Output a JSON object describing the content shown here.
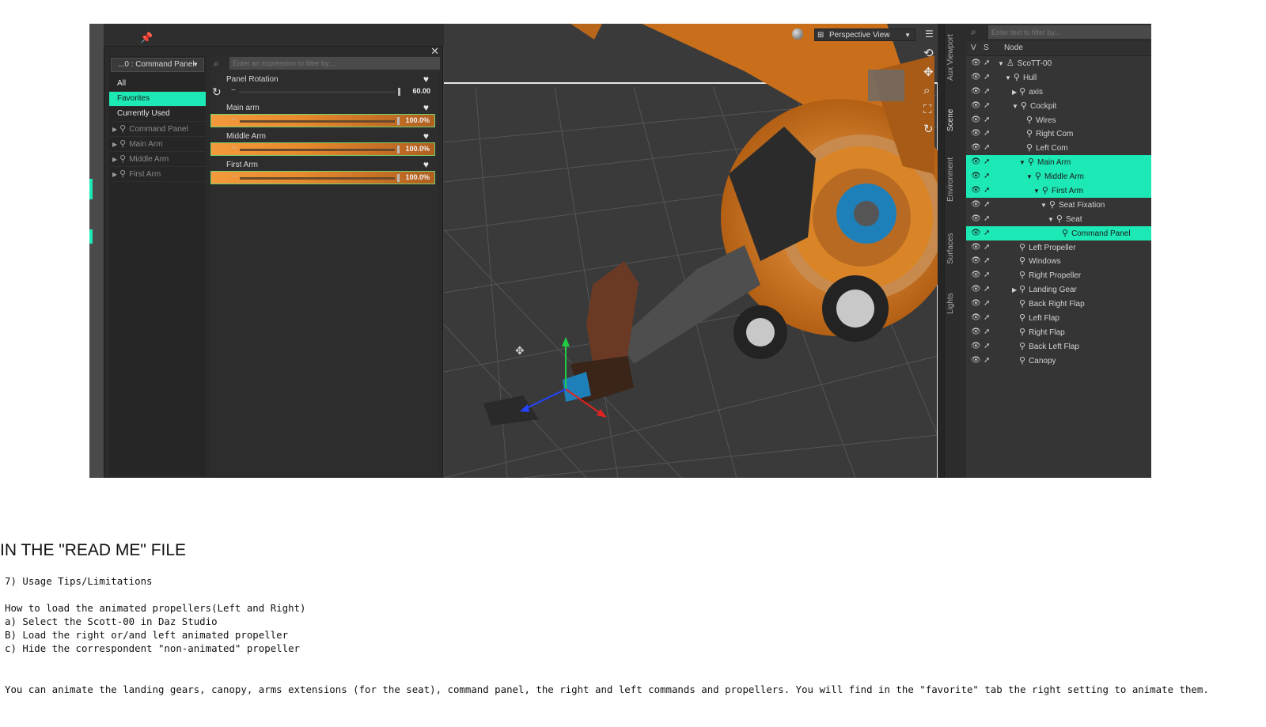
{
  "param_panel": {
    "category_dropdown": "...0 : Command Panel",
    "categories": [
      {
        "label": "All",
        "selected": false,
        "group": false
      },
      {
        "label": "Favorites",
        "selected": true,
        "group": false
      },
      {
        "label": "Currently Used",
        "selected": false,
        "group": false
      },
      {
        "label": "Command Panel",
        "selected": false,
        "group": true
      },
      {
        "label": "Main Arm",
        "selected": false,
        "group": true
      },
      {
        "label": "Middle Arm",
        "selected": false,
        "group": true
      },
      {
        "label": "First Arm",
        "selected": false,
        "group": true
      }
    ],
    "filter_placeholder": "Enter an expression to filter by...",
    "params": [
      {
        "name": "Panel Rotation",
        "value": "60.00",
        "highlight": false,
        "level": 0.95
      },
      {
        "name": "Main arm",
        "value": "100.0%",
        "highlight": true,
        "level": 1.0
      },
      {
        "name": "Middle Arm",
        "value": "100.0%",
        "highlight": true,
        "level": 1.0
      },
      {
        "name": "First Arm",
        "value": "100.0%",
        "highlight": true,
        "level": 1.0
      }
    ]
  },
  "viewport": {
    "view_label": "Perspective View"
  },
  "side_tabs": [
    "Aux Viewport",
    "Scene",
    "Environment",
    "Surfaces",
    "Lights"
  ],
  "scene": {
    "filter_placeholder": "Enter text to filter by...",
    "columns": {
      "v": "V",
      "s": "S",
      "node": "Node"
    },
    "nodes": [
      {
        "label": "ScoTT-00",
        "depth": 0,
        "expand": "down",
        "type": "figure",
        "selected": false
      },
      {
        "label": "Hull",
        "depth": 1,
        "expand": "down",
        "type": "bone",
        "selected": false
      },
      {
        "label": "axis",
        "depth": 2,
        "expand": "right",
        "type": "bone",
        "selected": false
      },
      {
        "label": "Cockpit",
        "depth": 2,
        "expand": "down",
        "type": "bone",
        "selected": false
      },
      {
        "label": "Wires",
        "depth": 3,
        "expand": "",
        "type": "bone",
        "selected": false
      },
      {
        "label": "Right Com",
        "depth": 3,
        "expand": "",
        "type": "bone",
        "selected": false
      },
      {
        "label": "Left Com",
        "depth": 3,
        "expand": "",
        "type": "bone",
        "selected": false
      },
      {
        "label": "Main Arm",
        "depth": 3,
        "expand": "down",
        "type": "bone",
        "selected": true
      },
      {
        "label": "Middle Arm",
        "depth": 4,
        "expand": "down",
        "type": "bone",
        "selected": true
      },
      {
        "label": "First Arm",
        "depth": 5,
        "expand": "down",
        "type": "bone",
        "selected": true
      },
      {
        "label": "Seat Fixation",
        "depth": 6,
        "expand": "down",
        "type": "bone",
        "selected": false
      },
      {
        "label": "Seat",
        "depth": 7,
        "expand": "down",
        "type": "bone",
        "selected": false
      },
      {
        "label": "Command Panel",
        "depth": 8,
        "expand": "",
        "type": "bone",
        "selected": true
      },
      {
        "label": "Left Propeller",
        "depth": 2,
        "expand": "",
        "type": "bone",
        "selected": false
      },
      {
        "label": "Windows",
        "depth": 2,
        "expand": "",
        "type": "bone",
        "selected": false
      },
      {
        "label": "Right Propeller",
        "depth": 2,
        "expand": "",
        "type": "bone",
        "selected": false
      },
      {
        "label": "Landing Gear",
        "depth": 2,
        "expand": "right",
        "type": "bone",
        "selected": false
      },
      {
        "label": "Back Right Flap",
        "depth": 2,
        "expand": "",
        "type": "bone",
        "selected": false
      },
      {
        "label": "Left Flap",
        "depth": 2,
        "expand": "",
        "type": "bone",
        "selected": false
      },
      {
        "label": "Right Flap",
        "depth": 2,
        "expand": "",
        "type": "bone",
        "selected": false
      },
      {
        "label": "Back Left Flap",
        "depth": 2,
        "expand": "",
        "type": "bone",
        "selected": false
      },
      {
        "label": "Canopy",
        "depth": 2,
        "expand": "",
        "type": "bone",
        "selected": false
      }
    ]
  },
  "colors": {
    "accent": "#1de9b6",
    "slider_orange": "#f39a3c",
    "model_orange": "#e0801e",
    "model_blue": "#1f7fb8"
  },
  "readme": {
    "heading": "IN THE \"READ ME\" FILE",
    "section": "7) Usage Tips/Limitations",
    "lines": [
      "How to load the animated propellers(Left and Right)",
      "a) Select the Scott-00 in Daz Studio",
      "B) Load the right or/and left animated propeller",
      "c) Hide the correspondent \"non-animated\" propeller"
    ],
    "note": "You can animate the landing gears, canopy, arms extensions (for the seat), command panel, the right and left commands and propellers. You will find in the \"favorite\" tab the right setting to animate them."
  }
}
